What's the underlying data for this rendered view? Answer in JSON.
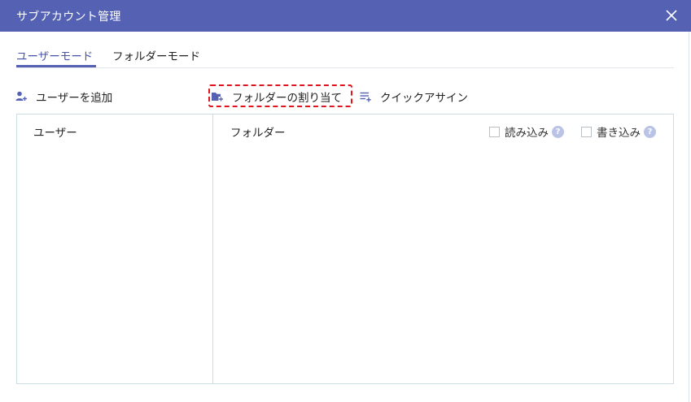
{
  "window": {
    "title": "サブアカウント管理",
    "close_icon": "close-icon"
  },
  "tabs": [
    {
      "label": "ユーザーモード",
      "active": true
    },
    {
      "label": "フォルダーモード",
      "active": false
    }
  ],
  "toolbar": {
    "add_user": {
      "label": "ユーザーを追加",
      "icon": "add-user-icon"
    },
    "assign_folder": {
      "label": "フォルダーの割り当て",
      "icon": "add-folder-icon",
      "highlighted": true
    },
    "quick_assign": {
      "label": "クイックアサイン",
      "icon": "list-add-icon"
    }
  },
  "panel": {
    "users_header": "ユーザー",
    "folders_header": "フォルダー",
    "read_label": "読み込み",
    "write_label": "書き込み",
    "help_symbol": "?"
  },
  "colors": {
    "titlebar": "#5562b4",
    "accent": "#5562b4",
    "highlight_border": "#e0141c",
    "panel_border": "#c9dde3",
    "help_badge": "#b9c3e6"
  }
}
